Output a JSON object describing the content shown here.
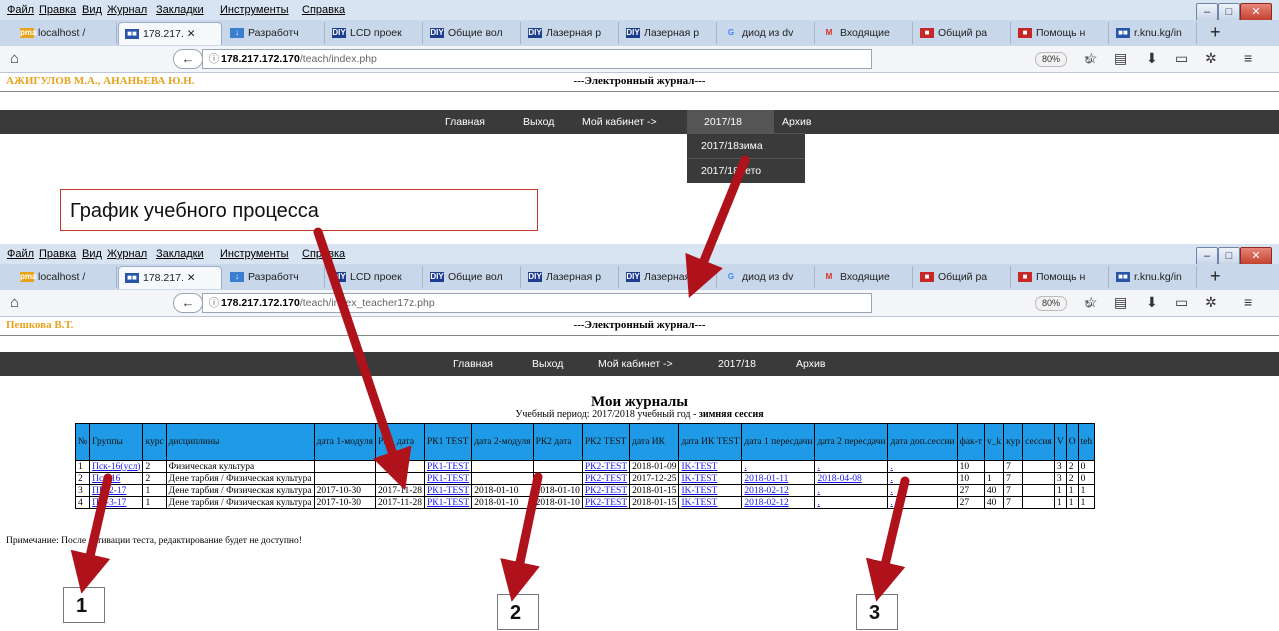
{
  "browser": {
    "menu": [
      "Файл",
      "Правка",
      "Вид",
      "Журнал",
      "Закладки",
      "Инструменты",
      "Справка"
    ],
    "tabs": [
      "localhost /",
      "178.217.",
      "Разработч",
      "LCD проек",
      "Общие вол",
      "Лазерная р",
      "Лазерная р",
      "диод из dv",
      "Входящие",
      "Общий ра",
      "Помощь н",
      "r.knu.kg/in"
    ],
    "zoom": "80%"
  },
  "shot1": {
    "url_host": "178.217.172.170",
    "url_path": "/teach/index.php",
    "user": "АЖИГУЛОВ М.А., АНАНЬЕВА Ю.Н.",
    "page_title": "---Электронный журнал---",
    "nav": [
      "Главная",
      "Выход",
      "Мой кабинет ->",
      "2017/18",
      "Архив"
    ],
    "dropdown": [
      "2017/18зима",
      "2017/18лето"
    ]
  },
  "callout": "График учебного процесса",
  "shot2": {
    "url_host": "178.217.172.170",
    "url_path": "/teach/index_teacher17z.php",
    "user": "Пешкова В.Т.",
    "page_title": "---Электронный журнал---",
    "nav": [
      "Главная",
      "Выход",
      "Мой кабинет ->",
      "2017/18",
      "Архив"
    ],
    "journals_title": "Мои журналы",
    "period_label": "Учебный период: 2017/2018 учебный год - ",
    "period_session": "зимняя сессия",
    "note": "Примечание: После активации теста, редактирование будет не доступно!"
  },
  "journal": {
    "headers": [
      "№",
      "Группы",
      "курс",
      "дисциплины",
      "дата 1-модуля",
      "РК1 дата",
      "РК1 TEST",
      "дата 2-модуля",
      "РК2 дата",
      "РК2 TEST",
      "дата ИК",
      "дата ИК TEST",
      "дата 1 пересдачи",
      "дата 2 пересдачи",
      "дата доп.сессии",
      "фак-т",
      "v_k",
      "кур",
      "сессия",
      "V",
      "O",
      "teh"
    ],
    "rows": [
      [
        "1",
        "Пск-16(усл)",
        "2",
        "Физическая культура",
        "",
        "",
        "РК1-TEST",
        "",
        "",
        "РК2-TEST",
        "2018-01-09",
        "IK-TEST",
        ".",
        ".",
        ".",
        "10",
        "",
        "7",
        "",
        "3",
        "2",
        "0"
      ],
      [
        "2",
        "Пск-16",
        "2",
        "Дене тарбия / Физическая культура",
        "",
        "",
        "РК1-TEST",
        "",
        "",
        "РК2-TEST",
        "2017-12-25",
        "IK-TEST",
        "2018-01-11",
        "2018-04-08",
        ".",
        "10",
        "1",
        "7",
        "",
        "3",
        "2",
        "0"
      ],
      [
        "3",
        "ПП-2-17",
        "1",
        "Дене тарбия / Физическая культура",
        "2017-10-30",
        "2017-11-28",
        "РК1-TEST",
        "2018-01-10",
        "2018-01-10",
        "РК2-TEST",
        "2018-01-15",
        "IK-TEST",
        "2018-02-12",
        ".",
        ".",
        "27",
        "40",
        "7",
        "",
        "1",
        "1",
        "1"
      ],
      [
        "4",
        "ПП-3-17",
        "1",
        "Дене тарбия / Физическая культура",
        "2017-10-30",
        "2017-11-28",
        "РК1-TEST",
        "2018-01-10",
        "2018-01-10",
        "РК2-TEST",
        "2018-01-15",
        "IK-TEST",
        "2018-02-12",
        ".",
        ".",
        "27",
        "40",
        "7",
        "",
        "1",
        "1",
        "1"
      ]
    ],
    "link_columns": [
      1,
      6,
      9,
      11,
      12,
      13,
      14
    ]
  },
  "markers": [
    "1",
    "2",
    "3"
  ],
  "colors": {
    "arrow": "#b0121b",
    "nav": "#3a3a3a",
    "header": "#1f9ae6",
    "user": "#e8a21c"
  }
}
